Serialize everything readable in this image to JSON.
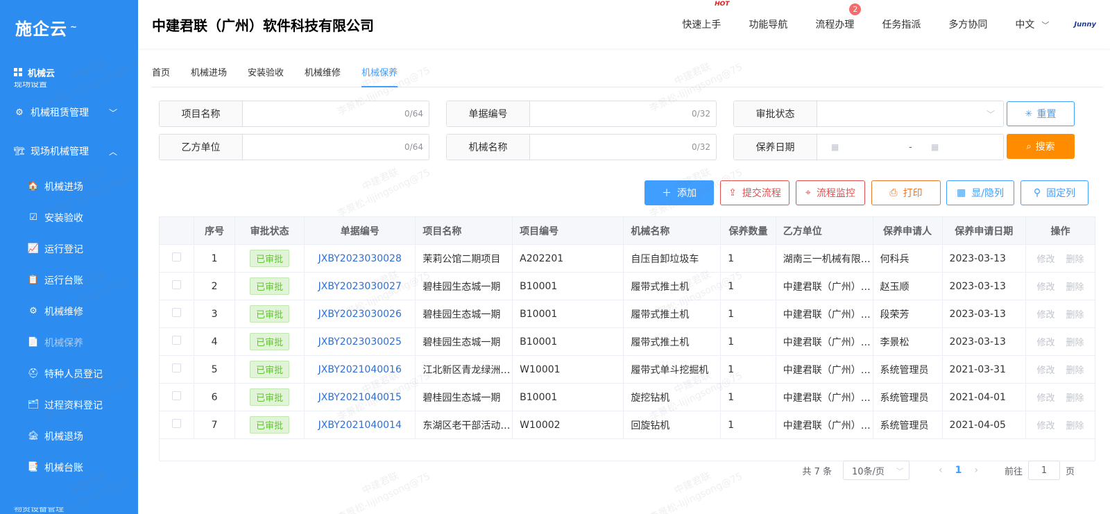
{
  "sidebar": {
    "logo": "施企云",
    "section": "机械云",
    "cut_item": "现场设置",
    "groups": [
      {
        "label": "机械租赁管理",
        "chev": "﹀"
      },
      {
        "label": "现场机械管理",
        "chev": "︿"
      }
    ],
    "items": [
      {
        "label": "机械进场",
        "icon": "🏠"
      },
      {
        "label": "安装验收",
        "icon": "☑"
      },
      {
        "label": "运行登记",
        "icon": "📈"
      },
      {
        "label": "运行台账",
        "icon": "📋"
      },
      {
        "label": "机械维修",
        "icon": "⚙"
      },
      {
        "label": "机械保养",
        "icon": "📄"
      },
      {
        "label": "特种人员登记",
        "icon": "⛑"
      },
      {
        "label": "过程资料登记",
        "icon": "🗂"
      },
      {
        "label": "机械退场",
        "icon": "🏚"
      },
      {
        "label": "机械台账",
        "icon": "📑"
      }
    ],
    "bottom_cut": "物资设备管理"
  },
  "header": {
    "company": "中建君联（广州）软件科技有限公司",
    "nav": [
      "快速上手",
      "功能导航",
      "流程办理",
      "任务指派",
      "多方协同"
    ],
    "hot": "HOT",
    "badge": "2",
    "lang": "中文",
    "brand": "Junny"
  },
  "tabs": [
    "首页",
    "机械进场",
    "安装验收",
    "机械维修",
    "机械保养"
  ],
  "search": {
    "project_name": {
      "label": "项目名称",
      "count": "0/64"
    },
    "doc_no": {
      "label": "单据编号",
      "count": "0/32"
    },
    "approval_status": {
      "label": "审批状态"
    },
    "party_b": {
      "label": "乙方单位",
      "count": "0/64"
    },
    "machine_name": {
      "label": "机械名称",
      "count": "0/32"
    },
    "maint_date": {
      "label": "保养日期",
      "sep": "-"
    },
    "reset": "重置",
    "search": "搜索"
  },
  "toolbar": {
    "add": "添加",
    "submit_flow": "提交流程",
    "flow_monitor": "流程监控",
    "print": "打印",
    "show_hide_cols": "显/隐列",
    "fix_cols": "固定列"
  },
  "table": {
    "headers": [
      "序号",
      "审批状态",
      "单据编号",
      "项目名称",
      "项目编号",
      "机械名称",
      "保养数量",
      "乙方单位",
      "保养申请人",
      "保养申请日期",
      "操作"
    ],
    "rows": [
      {
        "no": "1",
        "status": "已审批",
        "doc": "JXBY2023030028",
        "project": "茉莉公馆二期项目",
        "pcode": "A202201",
        "machine": "自压自卸垃圾车",
        "qty": "1",
        "party": "湖南三一机械有限公司",
        "applicant": "何科兵",
        "date": "2023-03-13"
      },
      {
        "no": "2",
        "status": "已审批",
        "doc": "JXBY2023030027",
        "project": "碧桂园生态城一期",
        "pcode": "B10001",
        "machine": "履带式推土机",
        "qty": "1",
        "party": "中建君联（广州）软件科技有限公司",
        "applicant": "赵玉顺",
        "date": "2023-03-13"
      },
      {
        "no": "3",
        "status": "已审批",
        "doc": "JXBY2023030026",
        "project": "碧桂园生态城一期",
        "pcode": "B10001",
        "machine": "履带式推土机",
        "qty": "1",
        "party": "中建君联（广州）软件科技有限公司",
        "applicant": "段荣芳",
        "date": "2023-03-13"
      },
      {
        "no": "4",
        "status": "已审批",
        "doc": "JXBY2023030025",
        "project": "碧桂园生态城一期",
        "pcode": "B10001",
        "machine": "履带式推土机",
        "qty": "1",
        "party": "中建君联（广州）软件科技有限公司",
        "applicant": "李景松",
        "date": "2023-03-13"
      },
      {
        "no": "5",
        "status": "已审批",
        "doc": "JXBY2021040016",
        "project": "江北新区青龙绿洲项目",
        "pcode": "W10001",
        "machine": "履带式单斗挖掘机",
        "qty": "1",
        "party": "中建君联（广州）软件科技有限公司",
        "applicant": "系统管理员",
        "date": "2021-03-31"
      },
      {
        "no": "6",
        "status": "已审批",
        "doc": "JXBY2021040015",
        "project": "碧桂园生态城一期",
        "pcode": "B10001",
        "machine": "旋挖钻机",
        "qty": "1",
        "party": "中建君联（广州）软件科技有限公司",
        "applicant": "系统管理员",
        "date": "2021-04-01"
      },
      {
        "no": "7",
        "status": "已审批",
        "doc": "JXBY2021040014",
        "project": "东湖区老干部活动中心",
        "pcode": "W10002",
        "machine": "回旋钻机",
        "qty": "1",
        "party": "中建君联（广州）软件科技有限公司",
        "applicant": "系统管理员",
        "date": "2021-04-05"
      }
    ],
    "op_edit": "修改",
    "op_delete": "删除"
  },
  "pager": {
    "total": "共 7 条",
    "size": "10条/页",
    "current": "1",
    "goto_prefix": "前往",
    "goto_value": "1",
    "goto_suffix": "页"
  },
  "watermark": {
    "company": "中建君联",
    "user": "李景松-lijingsong@75"
  }
}
